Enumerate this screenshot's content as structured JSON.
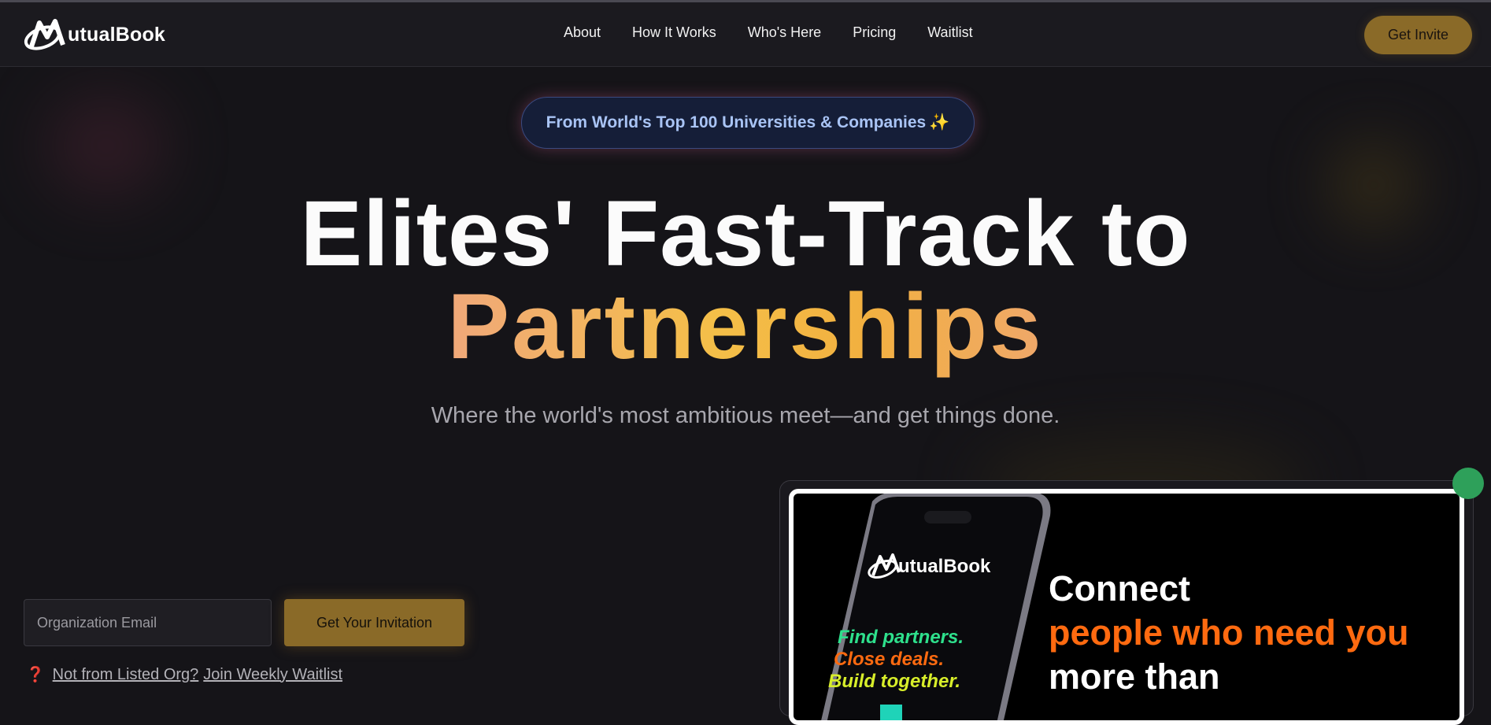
{
  "nav": {
    "logo_text": "utualBook",
    "links": [
      "About",
      "How It Works",
      "Who's Here",
      "Pricing",
      "Waitlist"
    ],
    "cta": "Get Invite"
  },
  "badge": {
    "text": "From World's Top 100 Universities & Companies",
    "emoji": "✨"
  },
  "hero": {
    "line1": "Elites' Fast-Track to",
    "line2": "Partnerships",
    "subtitle": "Where the world's most ambitious meet—and get things done."
  },
  "form": {
    "email_placeholder": "Organization Email",
    "email_value": "",
    "submit_label": "Get Your Invitation",
    "question_icon": "❓",
    "not_listed": "Not from Listed Org?",
    "join_waitlist": "Join Weekly Waitlist"
  },
  "promo": {
    "phone_logo": "utualBook",
    "phone_lines": [
      "Find partners.",
      "Close deals.",
      "Build together."
    ],
    "headline_1": "Connect",
    "headline_2": "people who need you",
    "headline_3": "more than"
  },
  "colors": {
    "accent_gold": "#8a6a28",
    "hero_gradient": "#f4bf48",
    "promo_orange": "#ff6a10"
  }
}
